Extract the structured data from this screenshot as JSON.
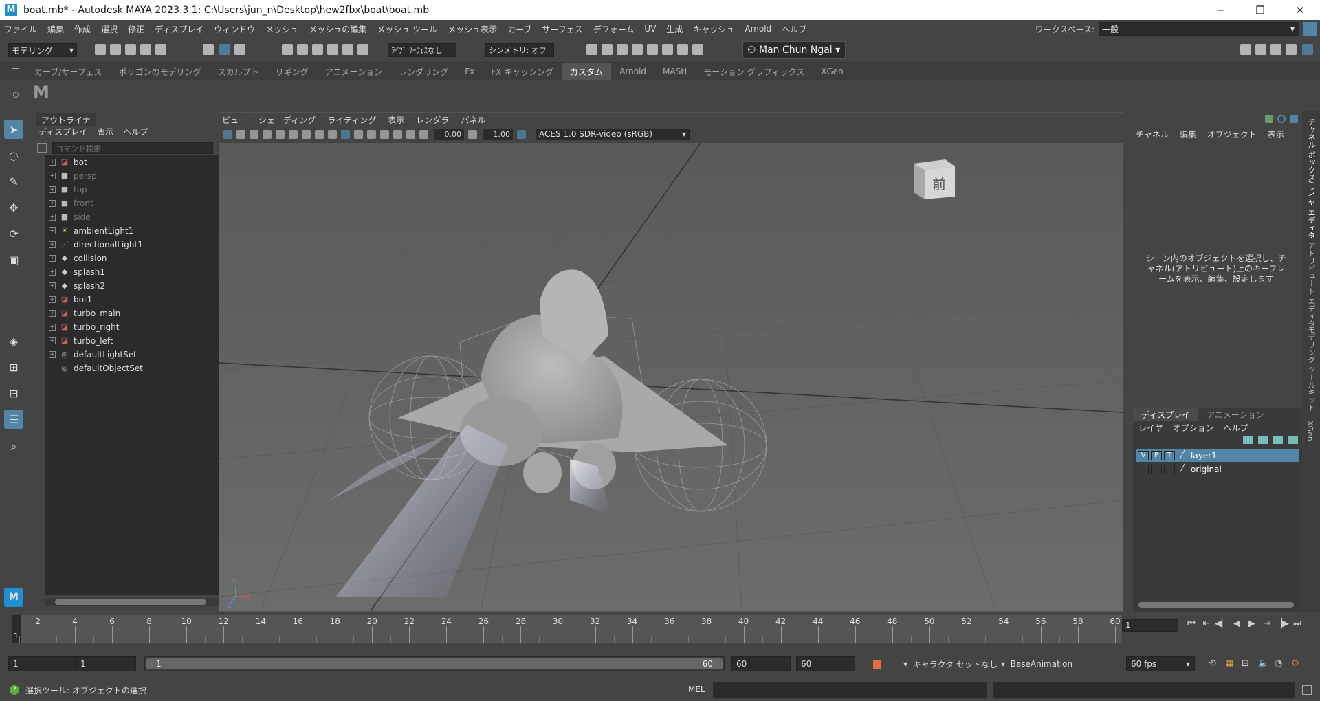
{
  "window": {
    "title": "boat.mb* - Autodesk MAYA 2023.3.1: C:\\Users\\jun_n\\Desktop\\hew2fbx\\boat\\boat.mb",
    "logo": "M",
    "minimize": "─",
    "maximize": "❐",
    "close": "✕"
  },
  "menubar": [
    "ファイル",
    "編集",
    "作成",
    "選択",
    "修正",
    "ディスプレイ",
    "ウィンドウ",
    "メッシュ",
    "メッシュの編集",
    "メッシュ ツール",
    "メッシュ表示",
    "カーブ",
    "サーフェス",
    "デフォーム",
    "UV",
    "生成",
    "キャッシュ",
    "Arnold",
    "ヘルプ"
  ],
  "workspace": {
    "label": "ワークスペース:",
    "value": "一般"
  },
  "statusline": {
    "mode": "モデリング",
    "live_surface": "ﾗｲﾌﾞ ｻｰﾌｪｽなし",
    "symmetry": "シンメトリ: オフ",
    "user": "Man Chun Ngai"
  },
  "shelf": {
    "tabs": [
      "カーブ/サーフェス",
      "ポリゴンのモデリング",
      "スカルプト",
      "リギング",
      "アニメーション",
      "レンダリング",
      "Fx",
      "FX キャッシング",
      "カスタム",
      "Arnold",
      "MASH",
      "モーション グラフィックス",
      "XGen"
    ],
    "active": "カスタム",
    "logo": "M"
  },
  "outliner": {
    "tab": "アウトライナ",
    "menus": [
      "ディスプレイ",
      "表示",
      "ヘルプ"
    ],
    "search_placeholder": "コマンド検索...",
    "items": [
      {
        "name": "bot",
        "icon": "mesh-icon",
        "dim": false,
        "expand": true
      },
      {
        "name": "persp",
        "icon": "camera-icon",
        "dim": true,
        "expand": true
      },
      {
        "name": "top",
        "icon": "camera-icon",
        "dim": true,
        "expand": true
      },
      {
        "name": "front",
        "icon": "camera-icon",
        "dim": true,
        "expand": true
      },
      {
        "name": "side",
        "icon": "camera-icon",
        "dim": true,
        "expand": true
      },
      {
        "name": "ambientLight1",
        "icon": "ambient-light-icon",
        "dim": false,
        "expand": true
      },
      {
        "name": "directionalLight1",
        "icon": "directional-light-icon",
        "dim": false,
        "expand": true
      },
      {
        "name": "collision",
        "icon": "group-icon",
        "dim": false,
        "expand": true
      },
      {
        "name": "splash1",
        "icon": "group-icon",
        "dim": false,
        "expand": true
      },
      {
        "name": "splash2",
        "icon": "group-icon",
        "dim": false,
        "expand": true
      },
      {
        "name": "bot1",
        "icon": "mesh-icon",
        "dim": false,
        "expand": true
      },
      {
        "name": "turbo_main",
        "icon": "mesh-icon",
        "dim": false,
        "expand": true
      },
      {
        "name": "turbo_right",
        "icon": "mesh-icon",
        "dim": false,
        "expand": true
      },
      {
        "name": "turbo_left",
        "icon": "mesh-icon",
        "dim": false,
        "expand": true
      },
      {
        "name": "defaultLightSet",
        "icon": "set-icon",
        "dim": false,
        "expand": true
      },
      {
        "name": "defaultObjectSet",
        "icon": "set-icon",
        "dim": false,
        "expand": false
      }
    ]
  },
  "viewport": {
    "menus": [
      "ビュー",
      "シェーディング",
      "ライティング",
      "表示",
      "レンダラ",
      "パネル"
    ],
    "exposure": "0.00",
    "gamma": "1.00",
    "color_space": "ACES 1.0 SDR-video (sRGB)",
    "viewcube_label": "前",
    "axis_y": "Y",
    "axis_z": "Z",
    "axis_x": "X"
  },
  "channelbox": {
    "menus": [
      "チャネル",
      "編集",
      "オブジェクト",
      "表示"
    ],
    "message": "シーン内のオブジェクトを選択し、チャネル(アトリビュート)上のキーフレームを表示、編集、設定します",
    "side_tabs": [
      "チャネル ボックス/レイヤ エディタ",
      "アトリビュート エディタ",
      "モデリング ツールキット",
      "XGen"
    ]
  },
  "layers": {
    "tabs": [
      "ディスプレイ",
      "アニメーション"
    ],
    "menus": [
      "レイヤ",
      "オプション",
      "ヘルプ"
    ],
    "rows": [
      {
        "v": "V",
        "p": "P",
        "t": "T",
        "name": "layer1",
        "selected": true
      },
      {
        "v": "",
        "p": "",
        "t": "",
        "name": "original",
        "selected": false
      }
    ]
  },
  "timeline": {
    "current_frame": "1",
    "frame_field": "1",
    "tick_labels": [
      "2",
      "4",
      "6",
      "8",
      "10",
      "12",
      "14",
      "16",
      "18",
      "20",
      "22",
      "24",
      "26",
      "28",
      "30",
      "32",
      "34",
      "36",
      "38",
      "40",
      "42",
      "44",
      "46",
      "48",
      "50",
      "52",
      "54",
      "56",
      "58",
      "60"
    ],
    "buttons": [
      "⏮",
      "⇤",
      "⏭",
      "◀",
      "▶",
      "⇥",
      "⏭",
      "⏭"
    ]
  },
  "range": {
    "start": "1",
    "anim_start": "1",
    "slider_start": "1",
    "slider_end": "60",
    "playback_end": "60",
    "anim_end": "60",
    "character_set": "キャラクタ セットなし",
    "anim_layer": "BaseAnimation",
    "fps": "60 fps"
  },
  "cmdline": {
    "help": "?",
    "message": "選択ツール: オブジェクトの選択",
    "lang": "MEL"
  }
}
